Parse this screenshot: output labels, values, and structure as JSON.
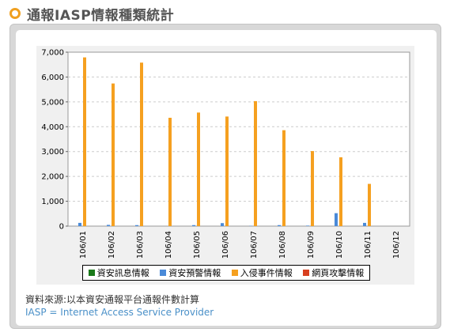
{
  "header": {
    "title": "通報IASP情報種類統計"
  },
  "footer": {
    "source": "資料來源:以本資安通報平台通報件數計算",
    "iasp": "IASP = Internet Access Service Provider"
  },
  "colors": {
    "bullet": "#f0a020",
    "series": [
      "#1a7a1a",
      "#4a8ad8",
      "#f5a020",
      "#d84020"
    ]
  },
  "chart_data": {
    "type": "bar",
    "categories": [
      "106/01",
      "106/02",
      "106/03",
      "106/04",
      "106/05",
      "106/06",
      "106/07",
      "106/08",
      "106/09",
      "106/10",
      "106/11",
      "106/12"
    ],
    "series": [
      {
        "name": "資安訊息情報",
        "values": [
          0,
          0,
          0,
          0,
          0,
          0,
          0,
          0,
          0,
          0,
          0,
          0
        ]
      },
      {
        "name": "資安預警情報",
        "values": [
          130,
          50,
          40,
          0,
          40,
          120,
          10,
          40,
          20,
          520,
          130,
          0
        ]
      },
      {
        "name": "入侵事件情報",
        "values": [
          6790,
          5740,
          6580,
          4360,
          4570,
          4410,
          5030,
          3860,
          3020,
          2770,
          1700,
          0
        ]
      },
      {
        "name": "網頁攻擊情報",
        "values": [
          0,
          0,
          0,
          0,
          0,
          0,
          0,
          0,
          0,
          0,
          0,
          0
        ]
      }
    ],
    "yticks": [
      "0",
      "1,000",
      "2,000",
      "3,000",
      "4,000",
      "5,000",
      "6,000",
      "7,000"
    ],
    "ylim": [
      0,
      7000
    ],
    "grid": true,
    "legend": "bottom"
  }
}
